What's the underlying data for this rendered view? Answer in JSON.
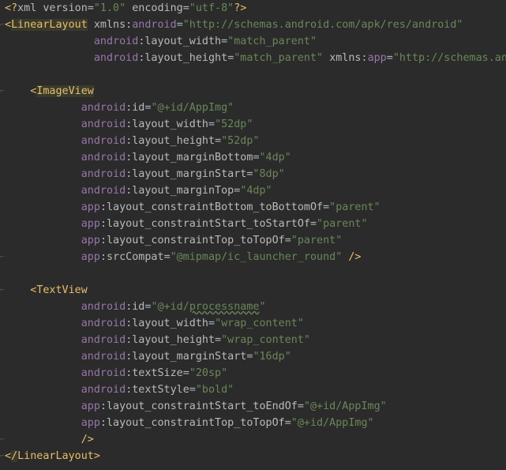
{
  "lines": [
    {
      "parts": [
        {
          "t": "<?",
          "c": "t-xmlpi"
        },
        {
          "t": "xml version",
          "c": "t-xmlkw"
        },
        {
          "t": "=",
          "c": "t-punct"
        },
        {
          "t": "\"1.0\"",
          "c": "t-str"
        },
        {
          "t": " encoding",
          "c": "t-xmlkw"
        },
        {
          "t": "=",
          "c": "t-punct"
        },
        {
          "t": "\"utf-8\"",
          "c": "t-str"
        },
        {
          "t": "?>",
          "c": "t-xmlpi"
        }
      ]
    },
    {
      "parts": [
        {
          "t": "<",
          "c": "t-angle"
        },
        {
          "t": "LinearLayout",
          "c": "t-tag-box"
        },
        {
          "t": " ",
          "c": "t-punct"
        },
        {
          "t": "xmlns:",
          "c": "t-attr"
        },
        {
          "t": "android",
          "c": "t-ns"
        },
        {
          "t": "=",
          "c": "t-punct"
        },
        {
          "t": "\"http://schemas.android.com/apk/res/android\"",
          "c": "t-str"
        }
      ]
    },
    {
      "parts": [
        {
          "t": "              ",
          "c": "t-punct"
        },
        {
          "t": "android",
          "c": "t-ns"
        },
        {
          "t": ":layout_width",
          "c": "t-attr"
        },
        {
          "t": "=",
          "c": "t-punct"
        },
        {
          "t": "\"match_parent\"",
          "c": "t-str"
        }
      ]
    },
    {
      "parts": [
        {
          "t": "              ",
          "c": "t-punct"
        },
        {
          "t": "android",
          "c": "t-ns"
        },
        {
          "t": ":layout_height",
          "c": "t-attr"
        },
        {
          "t": "=",
          "c": "t-punct"
        },
        {
          "t": "\"match_parent\"",
          "c": "t-str"
        },
        {
          "t": " ",
          "c": "t-punct"
        },
        {
          "t": "xmlns:",
          "c": "t-attr"
        },
        {
          "t": "app",
          "c": "t-ns"
        },
        {
          "t": "=",
          "c": "t-punct"
        },
        {
          "t": "\"http://schemas.and",
          "c": "t-str"
        }
      ]
    },
    {
      "parts": []
    },
    {
      "parts": [
        {
          "t": "    ",
          "c": "t-punct"
        },
        {
          "t": "<",
          "c": "t-angle"
        },
        {
          "t": "ImageView",
          "c": "t-tag-box"
        }
      ]
    },
    {
      "parts": [
        {
          "t": "            ",
          "c": "t-punct"
        },
        {
          "t": "android",
          "c": "t-ns"
        },
        {
          "t": ":id",
          "c": "t-attr"
        },
        {
          "t": "=",
          "c": "t-punct"
        },
        {
          "t": "\"@+id/AppImg\"",
          "c": "t-str"
        }
      ]
    },
    {
      "parts": [
        {
          "t": "            ",
          "c": "t-punct"
        },
        {
          "t": "android",
          "c": "t-ns"
        },
        {
          "t": ":layout_width",
          "c": "t-attr"
        },
        {
          "t": "=",
          "c": "t-punct"
        },
        {
          "t": "\"52dp\"",
          "c": "t-str"
        }
      ]
    },
    {
      "parts": [
        {
          "t": "            ",
          "c": "t-punct"
        },
        {
          "t": "android",
          "c": "t-ns"
        },
        {
          "t": ":layout_height",
          "c": "t-attr"
        },
        {
          "t": "=",
          "c": "t-punct"
        },
        {
          "t": "\"52dp\"",
          "c": "t-str"
        }
      ]
    },
    {
      "parts": [
        {
          "t": "            ",
          "c": "t-punct"
        },
        {
          "t": "android",
          "c": "t-ns"
        },
        {
          "t": ":layout_marginBottom",
          "c": "t-attr"
        },
        {
          "t": "=",
          "c": "t-punct"
        },
        {
          "t": "\"4dp\"",
          "c": "t-str"
        }
      ]
    },
    {
      "parts": [
        {
          "t": "            ",
          "c": "t-punct"
        },
        {
          "t": "android",
          "c": "t-ns"
        },
        {
          "t": ":layout_marginStart",
          "c": "t-attr"
        },
        {
          "t": "=",
          "c": "t-punct"
        },
        {
          "t": "\"8dp\"",
          "c": "t-str"
        }
      ]
    },
    {
      "parts": [
        {
          "t": "            ",
          "c": "t-punct"
        },
        {
          "t": "android",
          "c": "t-ns"
        },
        {
          "t": ":layout_marginTop",
          "c": "t-attr"
        },
        {
          "t": "=",
          "c": "t-punct"
        },
        {
          "t": "\"4dp\"",
          "c": "t-str"
        }
      ]
    },
    {
      "parts": [
        {
          "t": "            ",
          "c": "t-punct"
        },
        {
          "t": "app",
          "c": "t-ns"
        },
        {
          "t": ":layout_constraintBottom_toBottomOf",
          "c": "t-attr"
        },
        {
          "t": "=",
          "c": "t-punct"
        },
        {
          "t": "\"parent\"",
          "c": "t-str"
        }
      ]
    },
    {
      "parts": [
        {
          "t": "            ",
          "c": "t-punct"
        },
        {
          "t": "app",
          "c": "t-ns"
        },
        {
          "t": ":layout_constraintStart_toStartOf",
          "c": "t-attr"
        },
        {
          "t": "=",
          "c": "t-punct"
        },
        {
          "t": "\"parent\"",
          "c": "t-str"
        }
      ]
    },
    {
      "parts": [
        {
          "t": "            ",
          "c": "t-punct"
        },
        {
          "t": "app",
          "c": "t-ns"
        },
        {
          "t": ":layout_constraintTop_toTopOf",
          "c": "t-attr"
        },
        {
          "t": "=",
          "c": "t-punct"
        },
        {
          "t": "\"parent\"",
          "c": "t-str"
        }
      ]
    },
    {
      "parts": [
        {
          "t": "            ",
          "c": "t-punct"
        },
        {
          "t": "app",
          "c": "t-ns"
        },
        {
          "t": ":srcCompat",
          "c": "t-attr"
        },
        {
          "t": "=",
          "c": "t-punct"
        },
        {
          "t": "\"@mipmap/ic_launcher_round\"",
          "c": "t-str"
        },
        {
          "t": " ",
          "c": "t-punct"
        },
        {
          "t": "/>",
          "c": "t-angle"
        }
      ]
    },
    {
      "parts": []
    },
    {
      "parts": [
        {
          "t": "    ",
          "c": "t-punct"
        },
        {
          "t": "<",
          "c": "t-angle"
        },
        {
          "t": "TextView",
          "c": "t-tag"
        }
      ]
    },
    {
      "parts": [
        {
          "t": "            ",
          "c": "t-punct"
        },
        {
          "t": "android",
          "c": "t-ns"
        },
        {
          "t": ":id",
          "c": "t-attr"
        },
        {
          "t": "=",
          "c": "t-punct"
        },
        {
          "t": "\"@+id/",
          "c": "t-str"
        },
        {
          "t": "processname",
          "c": "t-str t-squiggle"
        },
        {
          "t": "\"",
          "c": "t-str"
        }
      ]
    },
    {
      "parts": [
        {
          "t": "            ",
          "c": "t-punct"
        },
        {
          "t": "android",
          "c": "t-ns"
        },
        {
          "t": ":layout_width",
          "c": "t-attr"
        },
        {
          "t": "=",
          "c": "t-punct"
        },
        {
          "t": "\"wrap_content\"",
          "c": "t-str"
        }
      ]
    },
    {
      "parts": [
        {
          "t": "            ",
          "c": "t-punct"
        },
        {
          "t": "android",
          "c": "t-ns"
        },
        {
          "t": ":layout_height",
          "c": "t-attr"
        },
        {
          "t": "=",
          "c": "t-punct"
        },
        {
          "t": "\"wrap_content\"",
          "c": "t-str"
        }
      ]
    },
    {
      "parts": [
        {
          "t": "            ",
          "c": "t-punct"
        },
        {
          "t": "android",
          "c": "t-ns"
        },
        {
          "t": ":layout_marginStart",
          "c": "t-attr"
        },
        {
          "t": "=",
          "c": "t-punct"
        },
        {
          "t": "\"16dp\"",
          "c": "t-str"
        }
      ]
    },
    {
      "parts": [
        {
          "t": "            ",
          "c": "t-punct"
        },
        {
          "t": "android",
          "c": "t-ns"
        },
        {
          "t": ":textSize",
          "c": "t-attr"
        },
        {
          "t": "=",
          "c": "t-punct"
        },
        {
          "t": "\"20sp\"",
          "c": "t-str"
        }
      ]
    },
    {
      "parts": [
        {
          "t": "            ",
          "c": "t-punct"
        },
        {
          "t": "android",
          "c": "t-ns"
        },
        {
          "t": ":textStyle",
          "c": "t-attr"
        },
        {
          "t": "=",
          "c": "t-punct"
        },
        {
          "t": "\"bold\"",
          "c": "t-str"
        }
      ]
    },
    {
      "parts": [
        {
          "t": "            ",
          "c": "t-punct"
        },
        {
          "t": "app",
          "c": "t-ns"
        },
        {
          "t": ":layout_constraintStart_toEndOf",
          "c": "t-attr"
        },
        {
          "t": "=",
          "c": "t-punct"
        },
        {
          "t": "\"@+id/AppImg\"",
          "c": "t-str"
        }
      ]
    },
    {
      "parts": [
        {
          "t": "            ",
          "c": "t-punct"
        },
        {
          "t": "app",
          "c": "t-ns"
        },
        {
          "t": ":layout_constraintTop_toTopOf",
          "c": "t-attr"
        },
        {
          "t": "=",
          "c": "t-punct"
        },
        {
          "t": "\"@+id/AppImg\"",
          "c": "t-str"
        }
      ]
    },
    {
      "parts": [
        {
          "t": "            ",
          "c": "t-punct"
        },
        {
          "t": "/>",
          "c": "t-angle"
        }
      ]
    },
    {
      "parts": [
        {
          "t": "<",
          "c": "t-angle"
        },
        {
          "t": "/",
          "c": "t-tag-box"
        },
        {
          "t": "LinearLayout",
          "c": "t-tag"
        },
        {
          "t": ">",
          "c": "t-angle"
        }
      ]
    }
  ],
  "colors": {
    "background": "#2b2b2b",
    "tag": "#e8bf6a",
    "namespace": "#9876aa",
    "attribute": "#bababa",
    "string": "#6a8759"
  }
}
